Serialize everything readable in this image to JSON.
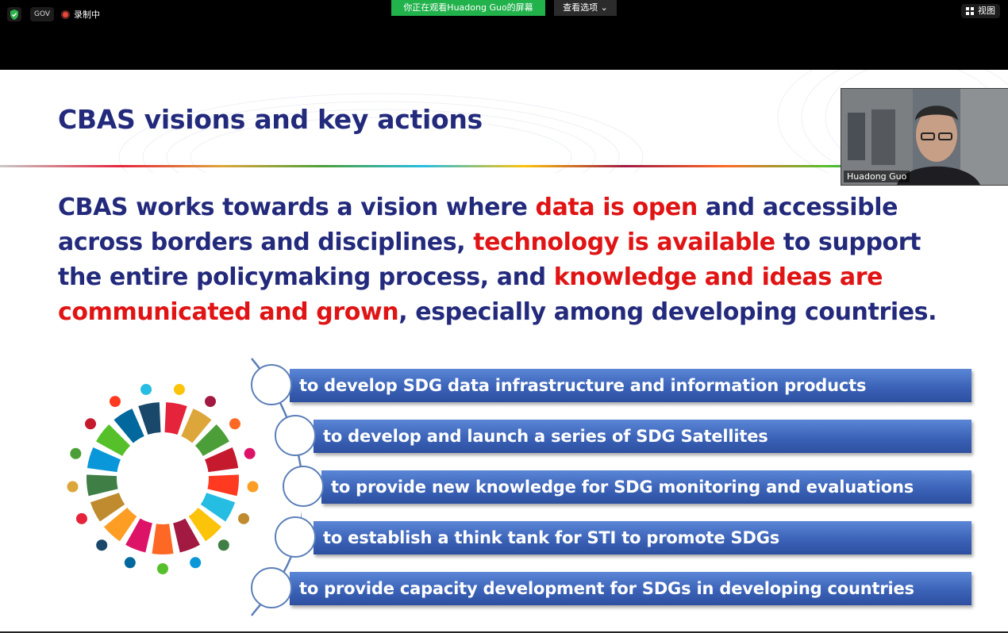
{
  "toolbar": {
    "security_icon": "shield-check-icon",
    "gov_label": "GOV",
    "recording_label": "录制中",
    "viewing_banner": "你正在观看Huadong Guo的屏幕",
    "view_options_label": "查看选项",
    "view_label": "视图"
  },
  "slide": {
    "title": "CBAS visions and key actions",
    "vision": {
      "part1": "CBAS works towards a vision where ",
      "hl1": "data is open",
      "part2": " and accessible across borders and disciplines, ",
      "hl2": "technology is available",
      "part3": " to support the entire policymaking process, and ",
      "hl3": "knowledge and ideas are communicated and grown",
      "part4": ", especially among developing countries."
    },
    "actions": [
      "to develop SDG data infrastructure and information products",
      "to develop and launch a series of SDG Satellites",
      "to provide new knowledge for SDG monitoring and evaluations",
      "to establish a think tank for STI to promote SDGs",
      "to provide capacity development for SDGs in developing countries"
    ]
  },
  "participant": {
    "name": "Huadong Guo"
  },
  "colors": {
    "title_color": "#232a7c",
    "highlight_color": "#e01414",
    "banner_color": "#21b24b",
    "action_bar_color": "#3b63b8"
  }
}
